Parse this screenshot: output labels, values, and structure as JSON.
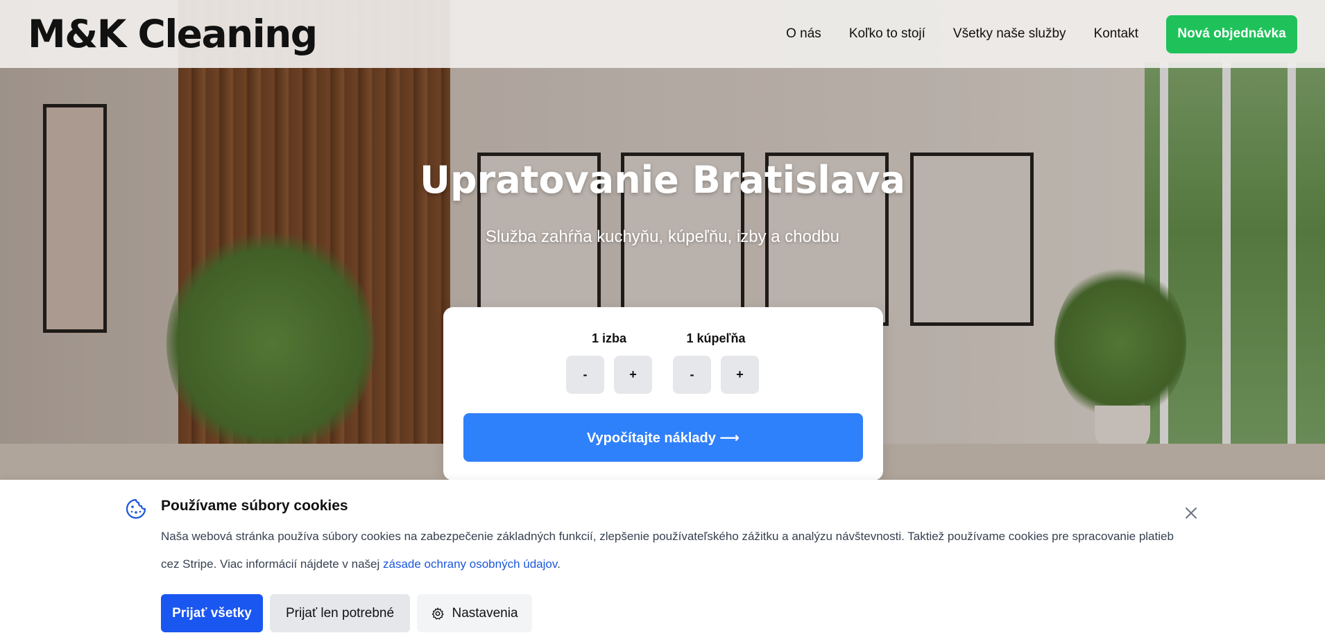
{
  "header": {
    "logo": "M&K Cleaning",
    "nav": [
      {
        "label": "O nás"
      },
      {
        "label": "Koľko to stojí"
      },
      {
        "label": "Všetky naše služby"
      },
      {
        "label": "Kontakt"
      }
    ],
    "cta_label": "Nová objednávka",
    "cta_color": "#1fc25a"
  },
  "hero": {
    "title": "Upratovanie Bratislava",
    "subtitle": "Služba zahŕňa kuchyňu, kúpeľňu, izby a chodbu"
  },
  "calculator": {
    "rooms": {
      "label": "1 izba",
      "minus": "-",
      "plus": "+"
    },
    "bathrooms": {
      "label": "1 kúpeľňa",
      "minus": "-",
      "plus": "+"
    },
    "submit_label": "Vypočítajte náklady ⟶",
    "accent_color": "#2f80fb"
  },
  "cookie_banner": {
    "icon": "cookie-icon",
    "title": "Používame súbory cookies",
    "text_before": "Naša webová stránka používa súbory cookies na zabezpečenie základných funkcií, zlepšenie používateľského zážitku a analýzu návštevnosti. Taktiež používame cookies pre spracovanie platieb cez Stripe. Viac informácií nájdete v našej ",
    "link_text": "zásade ochrany osobných údajov",
    "text_after": ".",
    "accept_all_label": "Prijať všetky",
    "accept_necessary_label": "Prijať len potrebné",
    "settings_label": "Nastavenia",
    "settings_icon": "gear-icon",
    "close_icon": "close-icon",
    "primary_color": "#1a56f0"
  }
}
